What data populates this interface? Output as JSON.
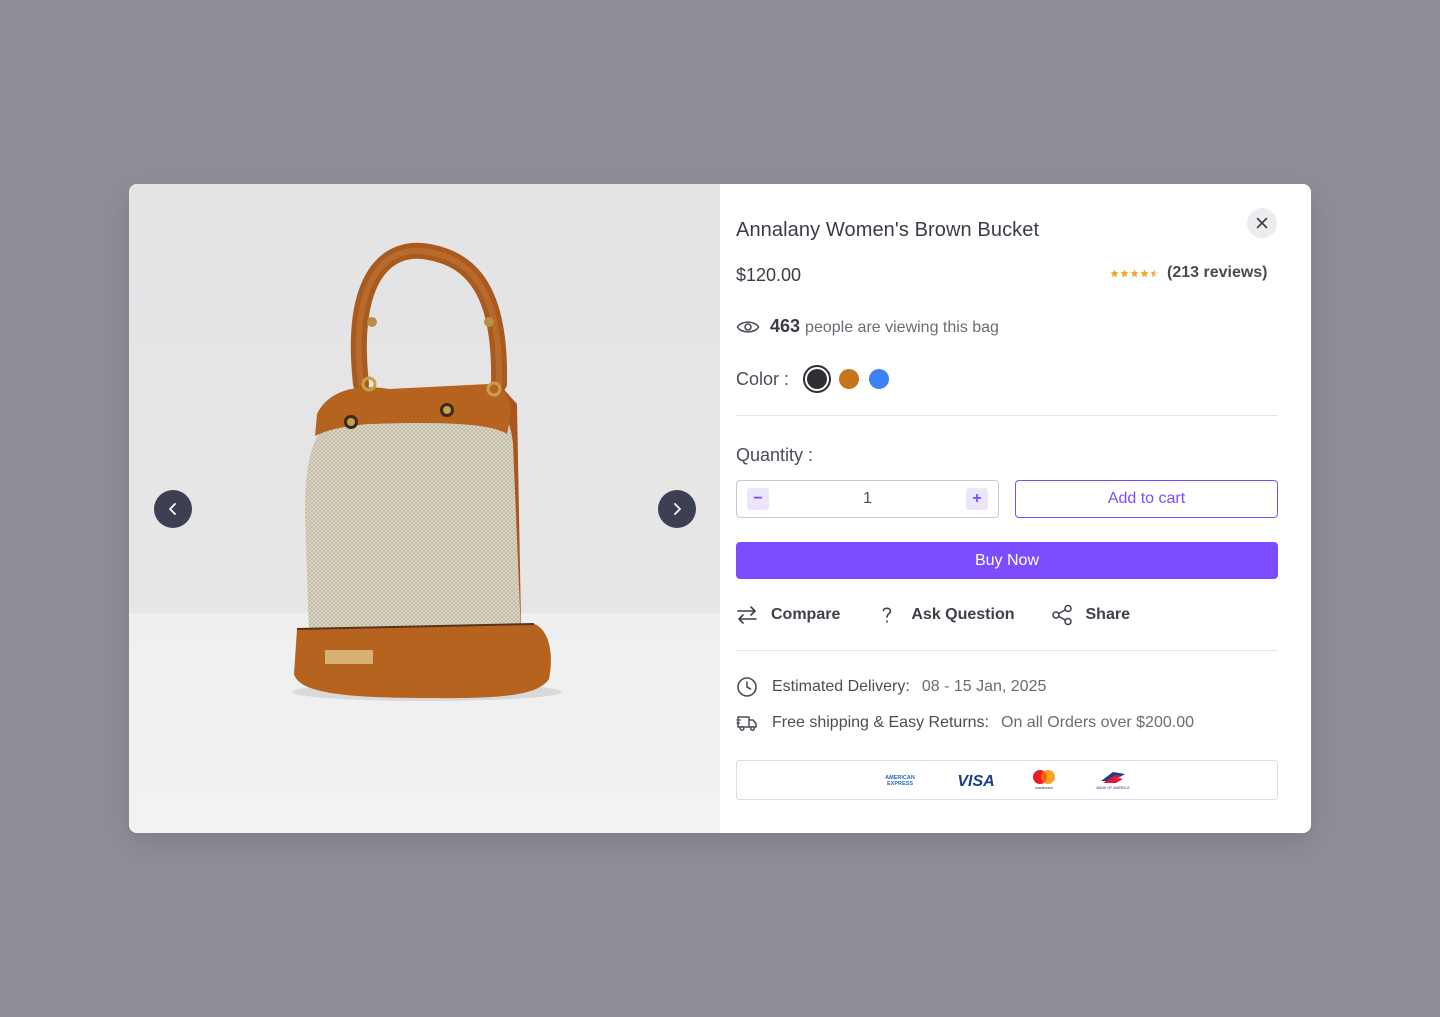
{
  "product": {
    "title": "Annalany Women's Brown Bucket",
    "price": "$120.00",
    "rating": 4.5,
    "reviews": "(213 reviews)",
    "viewers_count": "463",
    "viewers_text": "people are viewing this bag"
  },
  "color": {
    "label": "Color :",
    "options": [
      "#2f2f33",
      "#c6761a",
      "#3b82f6"
    ],
    "selected_index": 0
  },
  "quantity": {
    "label": "Quantity :",
    "value": "1",
    "minus": "−",
    "plus": "+"
  },
  "buttons": {
    "add_to_cart": "Add to cart",
    "buy_now": "Buy Now"
  },
  "actions": {
    "compare": "Compare",
    "ask": "Ask Question",
    "share": "Share"
  },
  "delivery": {
    "label": "Estimated Delivery:",
    "value": "08 - 15 Jan, 2025"
  },
  "shipping": {
    "label": "Free shipping & Easy Returns:",
    "value": "On all Orders over $200.00"
  },
  "payments": {
    "amex": "AMERICAN EXPRESS",
    "visa": "VISA",
    "mastercard": "mastercard",
    "boa": "BANK OF AMERICA"
  },
  "colors": {
    "accent": "#7c4dff",
    "star": "#f5a623",
    "backdrop": "#8e8e97"
  }
}
